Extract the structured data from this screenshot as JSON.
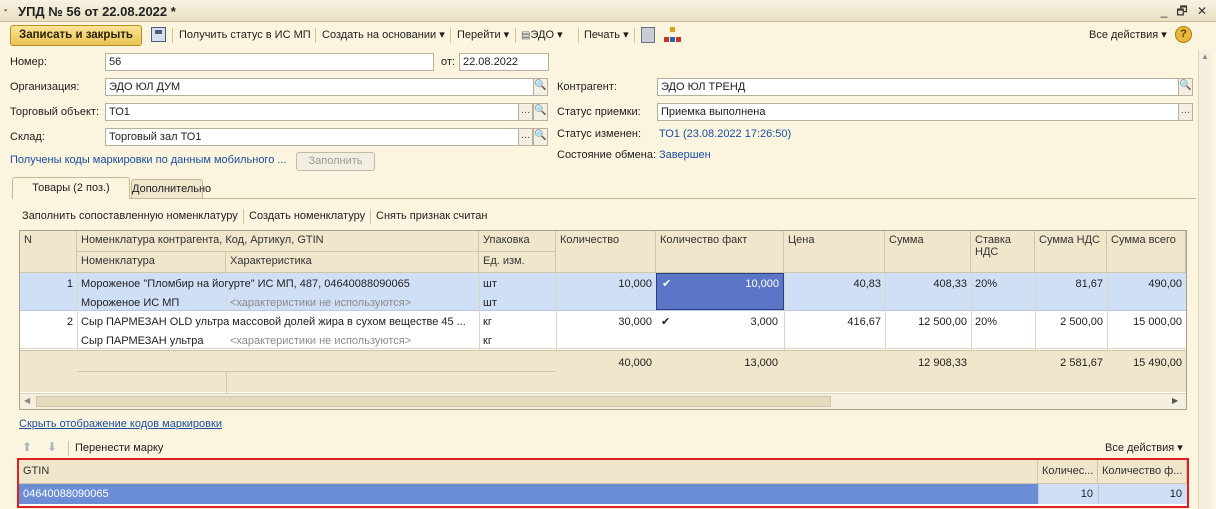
{
  "window": {
    "title": "УПД № 56 от 22.08.2022 *",
    "min": "_",
    "restore": "🗗",
    "close": "✕"
  },
  "toolbar": {
    "save_close": "Записать и закрыть",
    "get_status": "Получить статус в ИС МП",
    "create_based": "Создать на основании",
    "go": "Перейти",
    "edo": "ЭДО",
    "print": "Печать",
    "all_actions": "Все действия",
    "help": "?"
  },
  "form": {
    "number_label": "Номер:",
    "number": "56",
    "date_label": "от:",
    "date": "22.08.2022",
    "org_label": "Организация:",
    "org": "ЭДО ЮЛ ДУМ",
    "trade_label": "Торговый объект:",
    "trade": "ТО1",
    "wh_label": "Склад:",
    "wh": "Торговый зал ТО1",
    "mobile_link": "Получены коды маркировки по данным мобильного ...",
    "fill_btn": "Заполнить",
    "contr_label": "Контрагент:",
    "contr": "ЭДО ЮЛ ТРЕНД",
    "accept_label": "Статус приемки:",
    "accept": "Приемка выполнена",
    "changed_label": "Статус изменен:",
    "changed": "ТО1 (23.08.2022 17:26:50)",
    "exch_label": "Состояние обмена:",
    "exch": "Завершен"
  },
  "tabs": {
    "goods": "Товары (2 поз.)",
    "extra": "Дополнительно"
  },
  "goods_toolbar": {
    "fill": "Заполнить сопоставленную номенклатуру",
    "create": "Создать номенклатуру",
    "unset": "Снять признак считан"
  },
  "grid": {
    "headers": {
      "n": "N",
      "contr_nom": "Номенклатура контрагента, Код, Артикул, GTIN",
      "pack": "Упаковка",
      "qty": "Количество",
      "qty_fact": "Количество факт",
      "price": "Цена",
      "sum": "Сумма",
      "vat_rate": "Ставка НДС",
      "vat_sum": "Сумма НДС",
      "total": "Сумма всего",
      "nom": "Номенклатура",
      "char": "Характеристика",
      "unit": "Ед. изм."
    },
    "rows": [
      {
        "n": "1",
        "contr_nom": "Мороженое \"Пломбир на йогурте\" ИС МП, 487, 04640088090065",
        "nom": "Мороженое ИС МП",
        "char": "<характеристики не используются>",
        "pack": "шт",
        "unit": "шт",
        "qty": "10,000",
        "check": "✔",
        "qty_fact": "10,000",
        "price": "40,83",
        "sum": "408,33",
        "vat_rate": "20%",
        "vat_sum": "81,67",
        "total": "490,00"
      },
      {
        "n": "2",
        "contr_nom": "Сыр ПАРМЕЗАН OLD ультра  массовой долей жира  в сухом  веществе 45 ...",
        "nom": "Сыр ПАРМЕЗАН ультра",
        "char": "<характеристики не используются>",
        "pack": "кг",
        "unit": "кг",
        "qty": "30,000",
        "check": "✔",
        "qty_fact": "3,000",
        "price": "416,67",
        "sum": "12 500,00",
        "vat_rate": "20%",
        "vat_sum": "2 500,00",
        "total": "15 000,00"
      }
    ],
    "totals": {
      "qty": "40,000",
      "qty_fact": "13,000",
      "sum": "12 908,33",
      "vat_sum": "2 581,67",
      "total": "15 490,00"
    }
  },
  "hide_codes_link": "Скрыть отображение кодов маркировки",
  "mark_toolbar": {
    "move": "Перенести марку",
    "all_actions": "Все действия"
  },
  "mark_grid": {
    "headers": {
      "gtin": "GTIN",
      "qty": "Количес...",
      "qty_fact": "Количество ф..."
    },
    "rows": [
      {
        "gtin": "04640088090065",
        "qty": "10",
        "qty_fact": "10"
      }
    ]
  },
  "colors": {
    "accent": "#e9c255",
    "selection": "#6a8dd6",
    "row_highlight": "#cfe0f6"
  }
}
